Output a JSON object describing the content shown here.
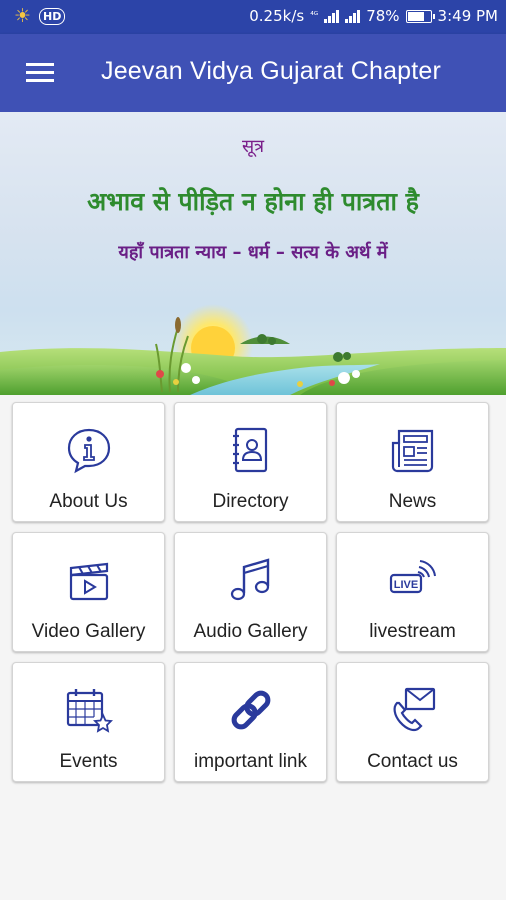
{
  "status_bar": {
    "net_speed": "0.25k/s",
    "battery_percent": "78%",
    "battery_level": 0.78,
    "time": "3:49 PM",
    "hd_badge": "HD"
  },
  "app_bar": {
    "title": "Jeevan Vidya Gujarat Chapter",
    "menu_icon": "hamburger-menu-icon"
  },
  "banner": {
    "heading": "सूत्र",
    "quote": "अभाव से पीड़ित न होना ही पात्रता है",
    "subquote": "यहाँ पात्रता न्याय – धर्म – सत्य के अर्थ में"
  },
  "menu": [
    {
      "label": "About Us",
      "icon": "info-chat-icon"
    },
    {
      "label": "Directory",
      "icon": "address-book-icon"
    },
    {
      "label": "News",
      "icon": "newspaper-icon"
    },
    {
      "label": "Video Gallery",
      "icon": "clapperboard-icon"
    },
    {
      "label": "Audio  Gallery",
      "icon": "music-note-icon"
    },
    {
      "label": "livestream",
      "icon": "live-broadcast-icon"
    },
    {
      "label": "Events",
      "icon": "calendar-star-icon"
    },
    {
      "label": "important link",
      "icon": "chain-link-icon"
    },
    {
      "label": "Contact us",
      "icon": "envelope-phone-icon"
    }
  ],
  "colors": {
    "status_bar": "#2c44a8",
    "app_bar": "#3f51b5",
    "icon_stroke": "#2a3a9c"
  }
}
